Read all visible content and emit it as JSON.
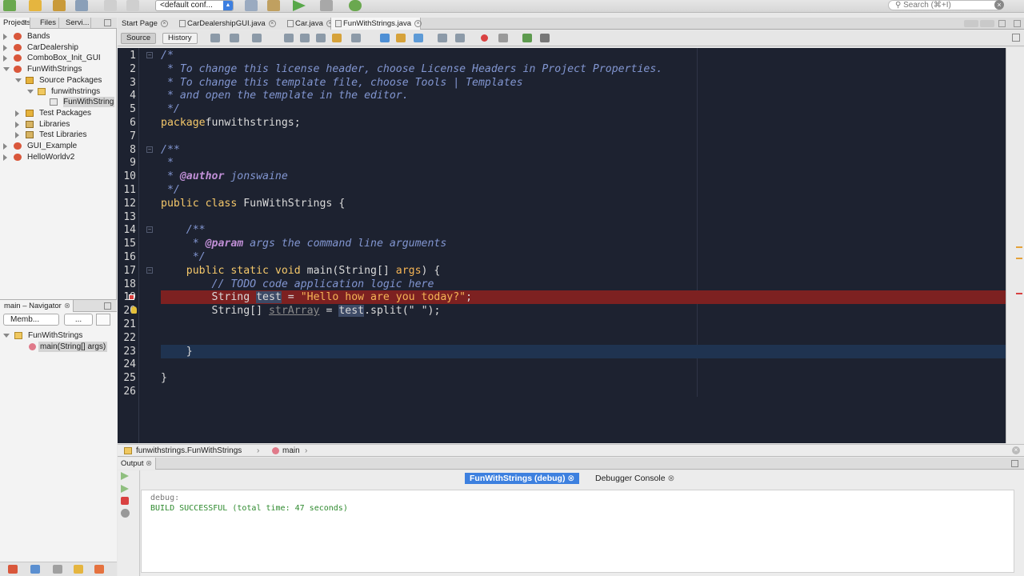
{
  "toolbar": {
    "config": "<default conf...",
    "search_placeholder": "Search (⌘+I)"
  },
  "left_tabs": [
    "Projects",
    "Files",
    "Servi..."
  ],
  "project_tree": [
    {
      "label": "Bands",
      "depth": 0,
      "icon": "project-icon",
      "expanded": false
    },
    {
      "label": "CarDealership",
      "depth": 0,
      "icon": "project-icon",
      "expanded": false
    },
    {
      "label": "ComboBox_Init_GUI",
      "depth": 0,
      "icon": "project-icon",
      "expanded": false
    },
    {
      "label": "FunWithStrings",
      "depth": 0,
      "icon": "project-icon",
      "expanded": true
    },
    {
      "label": "Source Packages",
      "depth": 1,
      "icon": "source-packages-icon",
      "expanded": true
    },
    {
      "label": "funwithstrings",
      "depth": 2,
      "icon": "package-icon",
      "expanded": true
    },
    {
      "label": "FunWithStrings.java",
      "depth": 3,
      "icon": "java-file-icon",
      "expanded": null
    },
    {
      "label": "Test Packages",
      "depth": 1,
      "icon": "test-packages-icon",
      "expanded": false
    },
    {
      "label": "Libraries",
      "depth": 1,
      "icon": "libraries-icon",
      "expanded": false
    },
    {
      "label": "Test Libraries",
      "depth": 1,
      "icon": "libraries-icon",
      "expanded": false
    },
    {
      "label": "GUI_Example",
      "depth": 0,
      "icon": "project-icon",
      "expanded": false
    },
    {
      "label": "HelloWorldv2",
      "depth": 0,
      "icon": "project-icon",
      "expanded": false
    }
  ],
  "navigator": {
    "title": "main – Navigator",
    "filter": "Memb...",
    "filter2": "...",
    "class_name": "FunWithStrings",
    "member": "main(String[] args)"
  },
  "editor_tabs": [
    "Start Page",
    "CarDealershipGUI.java",
    "Car.java",
    "FunWithStrings.java"
  ],
  "editor_toolbar": {
    "source": "Source",
    "history": "History"
  },
  "code_lines": [
    [
      [
        "c-com",
        "/*"
      ]
    ],
    [
      [
        "c-com",
        " * To change this license header, choose License Headers in Project Properties."
      ]
    ],
    [
      [
        "c-com",
        " * To change this template file, choose Tools | Templates"
      ]
    ],
    [
      [
        "c-com",
        " * and open the template in the editor."
      ]
    ],
    [
      [
        "c-com",
        " */"
      ]
    ],
    [
      [
        "c-kw",
        "package"
      ],
      [
        "",
        "funwithstrings;"
      ]
    ],
    [],
    [
      [
        "c-com",
        "/**"
      ]
    ],
    [
      [
        "c-com",
        " *"
      ]
    ],
    [
      [
        "c-com",
        " * "
      ],
      [
        "c-tag",
        "@author"
      ],
      [
        "c-com",
        " jonswaine"
      ]
    ],
    [
      [
        "c-com",
        " */"
      ]
    ],
    [
      [
        "c-kw",
        "public class"
      ],
      [
        "",
        " FunWithStrings {"
      ]
    ],
    [],
    [
      [
        "",
        "    "
      ],
      [
        "c-com",
        "/**"
      ]
    ],
    [
      [
        "",
        "    "
      ],
      [
        "c-com",
        " * "
      ],
      [
        "c-tag",
        "@param"
      ],
      [
        "c-com",
        " args the command line arguments"
      ]
    ],
    [
      [
        "",
        "    "
      ],
      [
        "c-com",
        " */"
      ]
    ],
    [
      [
        "",
        "    "
      ],
      [
        "c-kw",
        "public static void"
      ],
      [
        "",
        " main(String[] "
      ],
      [
        "c-arg",
        "args"
      ],
      [
        "",
        ") {"
      ]
    ],
    [
      [
        "",
        "        "
      ],
      [
        "c-com",
        "// TODO code application logic here"
      ]
    ],
    [
      [
        "",
        "        String "
      ],
      [
        "c-var-hl",
        "test"
      ],
      [
        "",
        " = "
      ],
      [
        "c-str",
        "\"Hello how are you today?\""
      ],
      [
        "",
        ";"
      ]
    ],
    [
      [
        "",
        "        String[] "
      ],
      [
        "c-unused",
        "strArray"
      ],
      [
        "",
        " = "
      ],
      [
        "c-var-hl",
        "test"
      ],
      [
        "",
        ".split(\" \");"
      ]
    ],
    [],
    [],
    [
      [
        "",
        "    }"
      ]
    ],
    [],
    [
      [
        "",
        "}"
      ]
    ],
    []
  ],
  "breadcrumb": {
    "class_path": "funwithstrings.FunWithStrings",
    "method": "main"
  },
  "output": {
    "panel_tab": "Output",
    "subtabs": [
      "FunWithStrings (debug)",
      "Debugger Console"
    ],
    "lines": [
      "debug:",
      "BUILD SUCCESSFUL (total time: 47 seconds)"
    ]
  }
}
